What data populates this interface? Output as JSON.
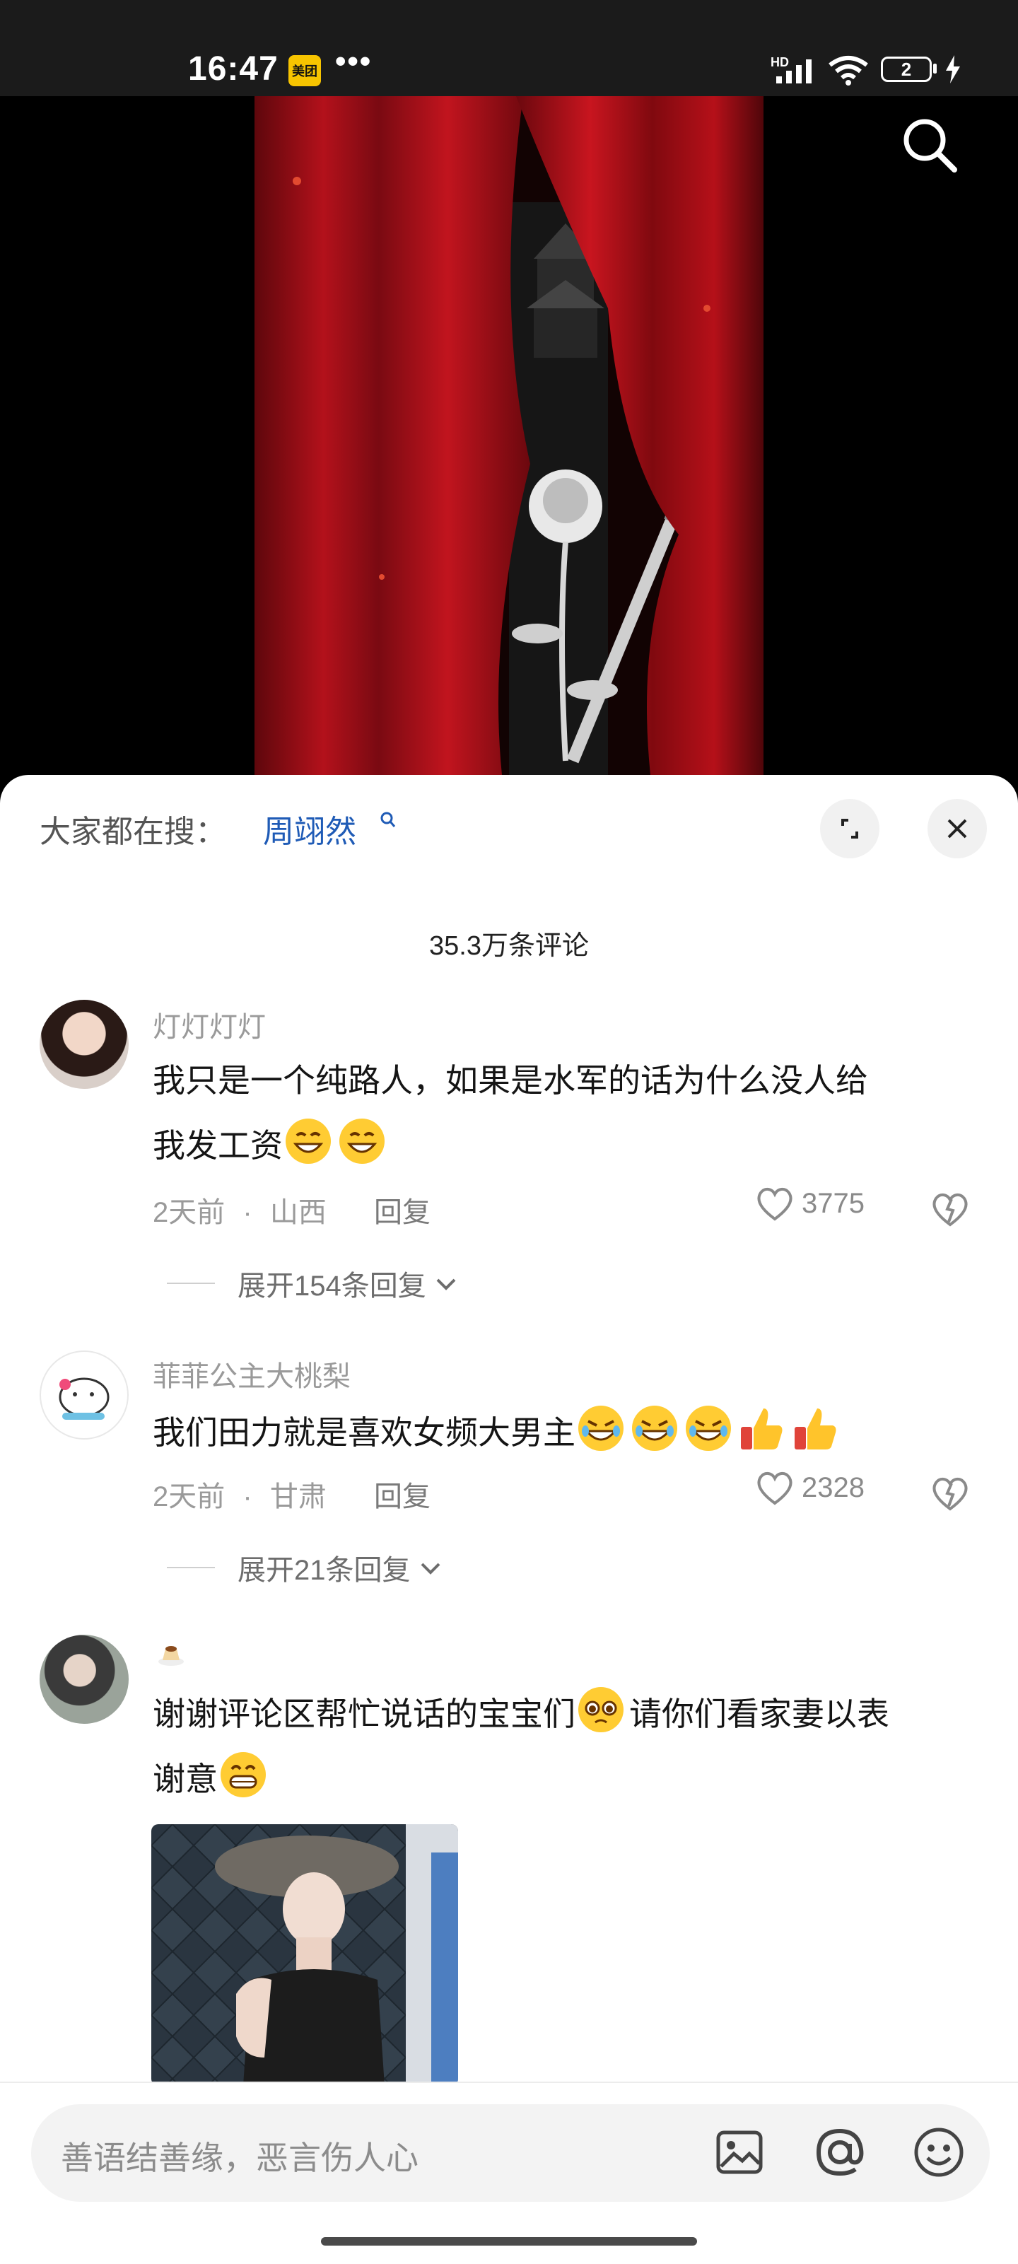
{
  "status_bar": {
    "time": "16:47",
    "app_badge": "美团",
    "more": "•••",
    "network": "HD",
    "battery": "2"
  },
  "hot_search": {
    "label": "大家都在搜：",
    "term": "周翊然"
  },
  "comments_count": "35.3万条评论",
  "comments": [
    {
      "username": "灯灯灯灯",
      "text_line1": "我只是一个纯路人，如果是水军的话为什么没人给",
      "text_line2": "我发工资",
      "time": "2天前",
      "location": "山西",
      "reply": "回复",
      "likes": "3775",
      "expand": "展开154条回复"
    },
    {
      "username": "菲菲公主大桃梨",
      "text": "我们田力就是喜欢女频大男主",
      "time": "2天前",
      "location": "甘肃",
      "reply": "回复",
      "likes": "2328",
      "expand": "展开21条回复"
    },
    {
      "username": "",
      "text_line1": "谢谢评论区帮忙说话的宝宝们",
      "text_line1b": "请你们看家妻以表",
      "text_line2": "谢意"
    }
  ],
  "meta_separator": "·",
  "input": {
    "placeholder": "善语结善缘，恶言伤人心"
  },
  "colors": {
    "accent_link": "#1f5bb6",
    "curtain_red": "#b3111b"
  }
}
